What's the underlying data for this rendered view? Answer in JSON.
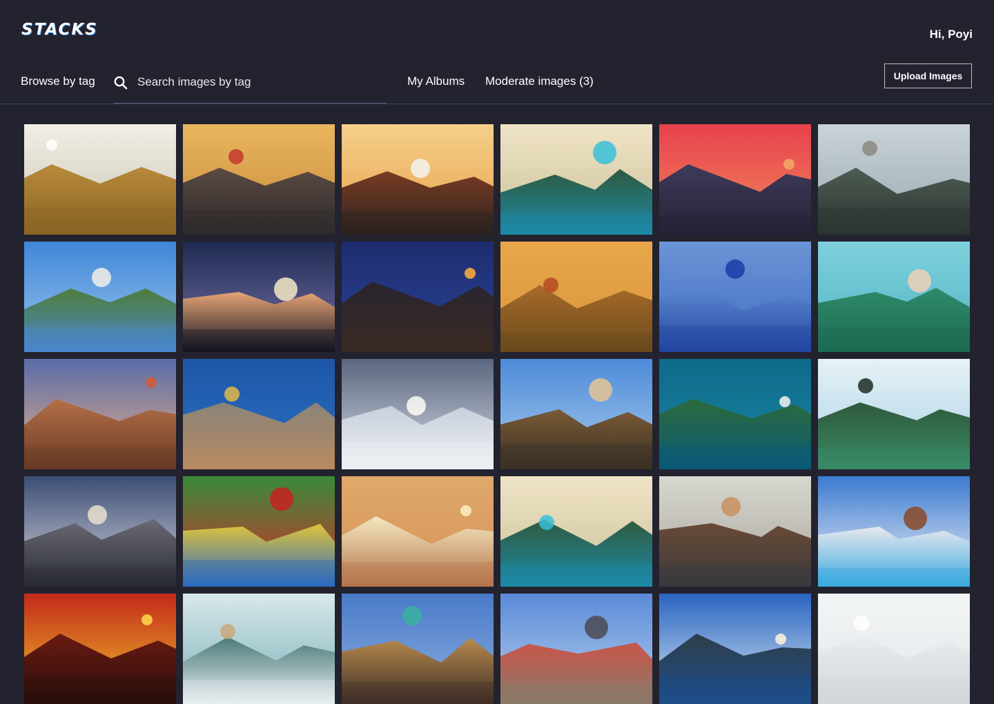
{
  "app": {
    "logo": "STACKS",
    "greeting": "Hi, Poyi"
  },
  "nav": {
    "browse_label": "Browse by tag",
    "search_placeholder": "Search images by tag",
    "my_albums_label": "My Albums",
    "moderate_label": "Moderate images (3)",
    "upload_label": "Upload Images"
  },
  "colors": {
    "background": "#23222f",
    "divider": "#34485f",
    "button_border": "#bfbfca"
  },
  "images": [
    {
      "subject": "savanna-grassland",
      "sky": "#f1efe6",
      "sky2": "#c9c3b4",
      "ground": "#b88a3a",
      "ground2": "#8a6424",
      "accent": "#ffffff"
    },
    {
      "subject": "hiker-mountain-sunset",
      "sky": "#e9b65d",
      "sky2": "#c98a3c",
      "ground": "#5a4a42",
      "ground2": "#2f2a2c",
      "accent": "#c23a30"
    },
    {
      "subject": "convertible-road-sunset",
      "sky": "#f4d08a",
      "sky2": "#e9a04c",
      "ground": "#7a3c22",
      "ground2": "#2c2220",
      "accent": "#f3f3ee"
    },
    {
      "subject": "palm-pool",
      "sky": "#f0e4c6",
      "sky2": "#c9c09a",
      "ground": "#2f5a3e",
      "ground2": "#1d8aa8",
      "accent": "#38c0d8"
    },
    {
      "subject": "pier-pink-sunset",
      "sky": "#e8404e",
      "sky2": "#f08a5a",
      "ground": "#3e3a5a",
      "ground2": "#262236",
      "accent": "#f5a86a"
    },
    {
      "subject": "cliff-valley",
      "sky": "#c9d3d8",
      "sky2": "#9aa8ad",
      "ground": "#4e5c52",
      "ground2": "#2a3430",
      "accent": "#8a8a80"
    },
    {
      "subject": "taj-mahal",
      "sky": "#3f86d8",
      "sky2": "#9cc6ee",
      "ground": "#4e7d3a",
      "ground2": "#4a88cf",
      "accent": "#f2efe8"
    },
    {
      "subject": "milky-way",
      "sky": "#1e2a52",
      "sky2": "#7a74a8",
      "ground": "#e6a476",
      "ground2": "#121421",
      "accent": "#f5e9c6"
    },
    {
      "subject": "beach-campfire",
      "sky": "#1e2c6e",
      "sky2": "#2a4598",
      "ground": "#2a2430",
      "ground2": "#3a2a24",
      "accent": "#ffb13a"
    },
    {
      "subject": "golden-temple-fields",
      "sky": "#e8a84a",
      "sky2": "#d9923a",
      "ground": "#a86b2a",
      "ground2": "#6a4a1c",
      "accent": "#b54a22"
    },
    {
      "subject": "blue-street",
      "sky": "#6c94d6",
      "sky2": "#3e6cc2",
      "ground": "#5a86d0",
      "ground2": "#2346a0",
      "accent": "#1c3ba8"
    },
    {
      "subject": "snorkeler",
      "sky": "#7fd0dc",
      "sky2": "#4fb4c4",
      "ground": "#2f8a6a",
      "ground2": "#1d6a52",
      "accent": "#f0d0b8"
    },
    {
      "subject": "hot-air-balloons",
      "sky": "#5a6ca8",
      "sky2": "#e7b08a",
      "ground": "#b47048",
      "ground2": "#6a3a26",
      "accent": "#d45a36"
    },
    {
      "subject": "mother-child-coast",
      "sky": "#1e56a8",
      "sky2": "#2a70c0",
      "ground": "#8a8478",
      "ground2": "#b88a62",
      "accent": "#e0b84a"
    },
    {
      "subject": "snowy-mountain-sky",
      "sky": "#5a6680",
      "sky2": "#d8dde6",
      "ground": "#c8d0dc",
      "ground2": "#eef0f4",
      "accent": "#fdfdf6"
    },
    {
      "subject": "canal-houses",
      "sky": "#4c8ad8",
      "sky2": "#a8cdee",
      "ground": "#7a5a36",
      "ground2": "#3a3024",
      "accent": "#e4c494"
    },
    {
      "subject": "cruise-ship",
      "sky": "#0e6a8a",
      "sky2": "#1a86a2",
      "ground": "#2c6a3a",
      "ground2": "#0a5a78",
      "accent": "#f2f2f2"
    },
    {
      "subject": "lagoon-boat",
      "sky": "#e6f2f6",
      "sky2": "#a8d0e6",
      "ground": "#2e5a3c",
      "ground2": "#3a8a66",
      "accent": "#1e2c24"
    },
    {
      "subject": "rainbow-beach",
      "sky": "#3c4e74",
      "sky2": "#d6d6de",
      "ground": "#6a6a74",
      "ground2": "#2a2c36",
      "accent": "#e8e2cc"
    },
    {
      "subject": "colorful-stairs",
      "sky": "#3a8a3a",
      "sky2": "#d82a2a",
      "ground": "#e0c43a",
      "ground2": "#2a6ac0",
      "accent": "#c8221e"
    },
    {
      "subject": "cheers-glasses",
      "sky": "#e0a86a",
      "sky2": "#d4935a",
      "ground": "#f3e8c0",
      "ground2": "#b5744a",
      "accent": "#fbf1c8"
    },
    {
      "subject": "palm-pool-2",
      "sky": "#f0e4c6",
      "sky2": "#c9c09a",
      "ground": "#2f5a3e",
      "ground2": "#1d8aa8",
      "accent": "#38c0d8"
    },
    {
      "subject": "city-crosswalk",
      "sky": "#d8d8d0",
      "sky2": "#a8a29a",
      "ground": "#6a4a36",
      "ground2": "#3a3a3e",
      "accent": "#c8905e"
    },
    {
      "subject": "resort-pool-clouds",
      "sky": "#3c7ad0",
      "sky2": "#f4f6f8",
      "ground": "#e8e8ee",
      "ground2": "#38a8e0",
      "accent": "#8a4a2a"
    },
    {
      "subject": "neon-street",
      "sky": "#c22a1a",
      "sky2": "#f0c02a",
      "ground": "#6a1a12",
      "ground2": "#2a0e0a",
      "accent": "#ffd84a"
    },
    {
      "subject": "balcony-fjord",
      "sky": "#d8e8ea",
      "sky2": "#7ab0b8",
      "ground": "#4a7a78",
      "ground2": "#e8eef2",
      "accent": "#c8a87a"
    },
    {
      "subject": "colonial-street",
      "sky": "#4a7ac8",
      "sky2": "#8ab0e0",
      "ground": "#b88a4e",
      "ground2": "#3e2e26",
      "accent": "#3ab0a0"
    },
    {
      "subject": "old-town-square",
      "sky": "#5a8ad8",
      "sky2": "#b8d0ee",
      "ground": "#c8564a",
      "ground2": "#8a7a6a",
      "accent": "#4a4a52"
    },
    {
      "subject": "lion-statue-sea",
      "sky": "#2a64c0",
      "sky2": "#d8e8f4",
      "ground": "#2e3e4a",
      "ground2": "#1e4e8a",
      "accent": "#fff6d8"
    },
    {
      "subject": "misty-sky",
      "sky": "#f2f4f5",
      "sky2": "#e4e8ea",
      "ground": "#e8ecee",
      "ground2": "#d0d6da",
      "accent": "#ffffff"
    }
  ]
}
